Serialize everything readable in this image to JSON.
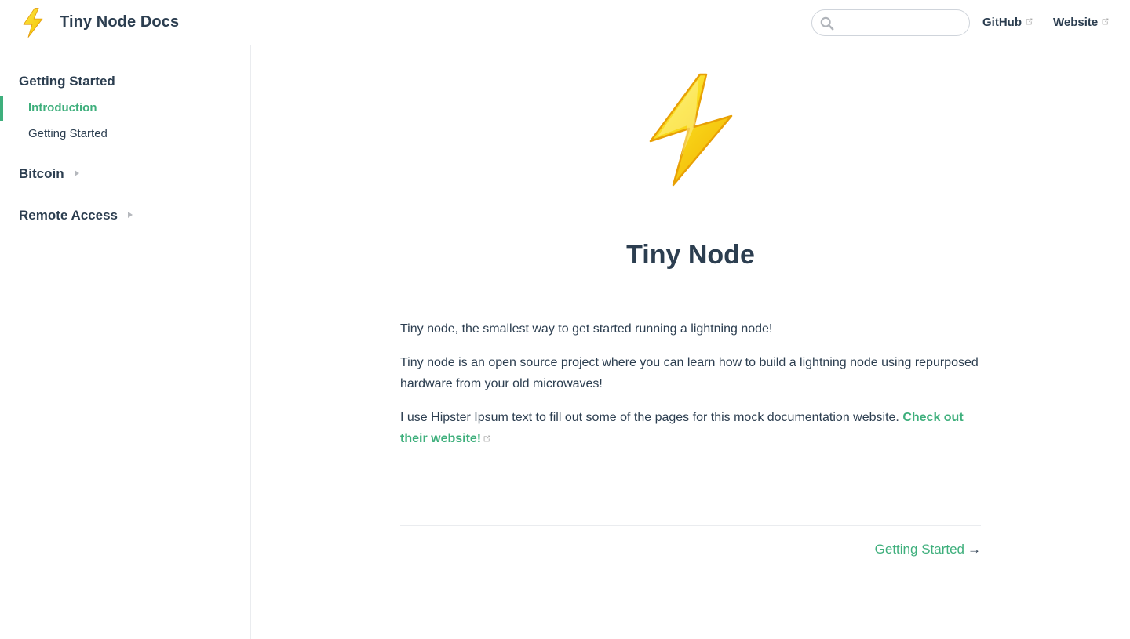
{
  "navbar": {
    "logo_icon": "lightning-bolt-icon",
    "site_name": "Tiny Node Docs",
    "search": {
      "value": "",
      "placeholder": ""
    },
    "links": [
      {
        "label": "GitHub",
        "icon": "external-link-icon"
      },
      {
        "label": "Website",
        "icon": "external-link-icon"
      }
    ]
  },
  "sidebar": {
    "groups": [
      {
        "title": "Getting Started",
        "expanded": true,
        "items": [
          {
            "label": "Introduction",
            "active": true
          },
          {
            "label": "Getting Started",
            "active": false
          }
        ]
      },
      {
        "title": "Bitcoin",
        "expanded": false,
        "icon": "collapse-arrow-icon"
      },
      {
        "title": "Remote Access",
        "expanded": false,
        "icon": "collapse-arrow-icon"
      }
    ]
  },
  "main": {
    "hero_icon": "lightning-bolt-icon",
    "title": "Tiny Node",
    "paragraphs": [
      "Tiny node, the smallest way to get started running a lightning node!",
      "Tiny node is an open source project where you can learn how to build a lightning node using repurposed hardware from your old microwaves!",
      "I use Hipster Ipsum text to fill out some of the pages for this mock documentation website."
    ],
    "paragraph3_link": "Check out their website!",
    "next": {
      "label": "Getting Started",
      "arrow": "→"
    }
  },
  "colors": {
    "accent": "#3eaf7c",
    "text": "#2c3e50",
    "border": "#eaecef",
    "bolt_yellow": "#f7d117",
    "bolt_orange": "#f0a30a"
  }
}
